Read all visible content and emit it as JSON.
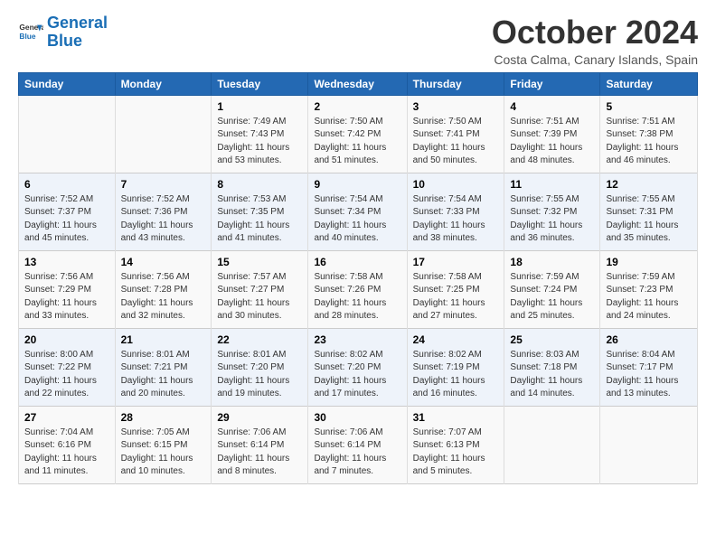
{
  "logo": {
    "line1": "General",
    "line2": "Blue"
  },
  "title": "October 2024",
  "location": "Costa Calma, Canary Islands, Spain",
  "days_of_week": [
    "Sunday",
    "Monday",
    "Tuesday",
    "Wednesday",
    "Thursday",
    "Friday",
    "Saturday"
  ],
  "weeks": [
    [
      {
        "day": "",
        "info": ""
      },
      {
        "day": "",
        "info": ""
      },
      {
        "day": "1",
        "info": "Sunrise: 7:49 AM\nSunset: 7:43 PM\nDaylight: 11 hours\nand 53 minutes."
      },
      {
        "day": "2",
        "info": "Sunrise: 7:50 AM\nSunset: 7:42 PM\nDaylight: 11 hours\nand 51 minutes."
      },
      {
        "day": "3",
        "info": "Sunrise: 7:50 AM\nSunset: 7:41 PM\nDaylight: 11 hours\nand 50 minutes."
      },
      {
        "day": "4",
        "info": "Sunrise: 7:51 AM\nSunset: 7:39 PM\nDaylight: 11 hours\nand 48 minutes."
      },
      {
        "day": "5",
        "info": "Sunrise: 7:51 AM\nSunset: 7:38 PM\nDaylight: 11 hours\nand 46 minutes."
      }
    ],
    [
      {
        "day": "6",
        "info": "Sunrise: 7:52 AM\nSunset: 7:37 PM\nDaylight: 11 hours\nand 45 minutes."
      },
      {
        "day": "7",
        "info": "Sunrise: 7:52 AM\nSunset: 7:36 PM\nDaylight: 11 hours\nand 43 minutes."
      },
      {
        "day": "8",
        "info": "Sunrise: 7:53 AM\nSunset: 7:35 PM\nDaylight: 11 hours\nand 41 minutes."
      },
      {
        "day": "9",
        "info": "Sunrise: 7:54 AM\nSunset: 7:34 PM\nDaylight: 11 hours\nand 40 minutes."
      },
      {
        "day": "10",
        "info": "Sunrise: 7:54 AM\nSunset: 7:33 PM\nDaylight: 11 hours\nand 38 minutes."
      },
      {
        "day": "11",
        "info": "Sunrise: 7:55 AM\nSunset: 7:32 PM\nDaylight: 11 hours\nand 36 minutes."
      },
      {
        "day": "12",
        "info": "Sunrise: 7:55 AM\nSunset: 7:31 PM\nDaylight: 11 hours\nand 35 minutes."
      }
    ],
    [
      {
        "day": "13",
        "info": "Sunrise: 7:56 AM\nSunset: 7:29 PM\nDaylight: 11 hours\nand 33 minutes."
      },
      {
        "day": "14",
        "info": "Sunrise: 7:56 AM\nSunset: 7:28 PM\nDaylight: 11 hours\nand 32 minutes."
      },
      {
        "day": "15",
        "info": "Sunrise: 7:57 AM\nSunset: 7:27 PM\nDaylight: 11 hours\nand 30 minutes."
      },
      {
        "day": "16",
        "info": "Sunrise: 7:58 AM\nSunset: 7:26 PM\nDaylight: 11 hours\nand 28 minutes."
      },
      {
        "day": "17",
        "info": "Sunrise: 7:58 AM\nSunset: 7:25 PM\nDaylight: 11 hours\nand 27 minutes."
      },
      {
        "day": "18",
        "info": "Sunrise: 7:59 AM\nSunset: 7:24 PM\nDaylight: 11 hours\nand 25 minutes."
      },
      {
        "day": "19",
        "info": "Sunrise: 7:59 AM\nSunset: 7:23 PM\nDaylight: 11 hours\nand 24 minutes."
      }
    ],
    [
      {
        "day": "20",
        "info": "Sunrise: 8:00 AM\nSunset: 7:22 PM\nDaylight: 11 hours\nand 22 minutes."
      },
      {
        "day": "21",
        "info": "Sunrise: 8:01 AM\nSunset: 7:21 PM\nDaylight: 11 hours\nand 20 minutes."
      },
      {
        "day": "22",
        "info": "Sunrise: 8:01 AM\nSunset: 7:20 PM\nDaylight: 11 hours\nand 19 minutes."
      },
      {
        "day": "23",
        "info": "Sunrise: 8:02 AM\nSunset: 7:20 PM\nDaylight: 11 hours\nand 17 minutes."
      },
      {
        "day": "24",
        "info": "Sunrise: 8:02 AM\nSunset: 7:19 PM\nDaylight: 11 hours\nand 16 minutes."
      },
      {
        "day": "25",
        "info": "Sunrise: 8:03 AM\nSunset: 7:18 PM\nDaylight: 11 hours\nand 14 minutes."
      },
      {
        "day": "26",
        "info": "Sunrise: 8:04 AM\nSunset: 7:17 PM\nDaylight: 11 hours\nand 13 minutes."
      }
    ],
    [
      {
        "day": "27",
        "info": "Sunrise: 7:04 AM\nSunset: 6:16 PM\nDaylight: 11 hours\nand 11 minutes."
      },
      {
        "day": "28",
        "info": "Sunrise: 7:05 AM\nSunset: 6:15 PM\nDaylight: 11 hours\nand 10 minutes."
      },
      {
        "day": "29",
        "info": "Sunrise: 7:06 AM\nSunset: 6:14 PM\nDaylight: 11 hours\nand 8 minutes."
      },
      {
        "day": "30",
        "info": "Sunrise: 7:06 AM\nSunset: 6:14 PM\nDaylight: 11 hours\nand 7 minutes."
      },
      {
        "day": "31",
        "info": "Sunrise: 7:07 AM\nSunset: 6:13 PM\nDaylight: 11 hours\nand 5 minutes."
      },
      {
        "day": "",
        "info": ""
      },
      {
        "day": "",
        "info": ""
      }
    ]
  ]
}
